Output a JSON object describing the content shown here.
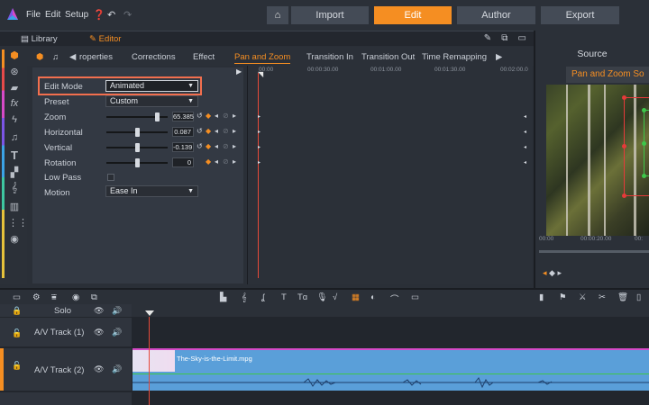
{
  "menu": {
    "file": "File",
    "edit": "Edit",
    "setup": "Setup"
  },
  "nav": {
    "import": "Import",
    "edit": "Edit",
    "author": "Author",
    "export": "Export"
  },
  "panel_tabs": {
    "library": "Library",
    "editor": "Editor"
  },
  "effect_tabs": [
    "roperties",
    "Corrections",
    "Effect",
    "Pan and Zoom",
    "Transition In",
    "Transition Out",
    "Time Remapping"
  ],
  "active_effect_tab": "Pan and Zoom",
  "properties": {
    "edit_mode_label": "Edit Mode",
    "edit_mode_value": "Animated",
    "preset_label": "Preset",
    "preset_value": "Custom",
    "zoom_label": "Zoom",
    "zoom_value": "65.385",
    "horizontal_label": "Horizontal",
    "horizontal_value": "0.087",
    "vertical_label": "Vertical",
    "vertical_value": "-0.139",
    "rotation_label": "Rotation",
    "rotation_value": "0",
    "low_pass_label": "Low Pass",
    "motion_label": "Motion",
    "motion_value": "Ease In"
  },
  "keyframe_ruler": [
    "00:00",
    "00:00:30.00",
    "00:01:00.00",
    "00:01:30.00",
    "00:02:00.0"
  ],
  "source": {
    "title": "Source",
    "subtitle": "Pan and Zoom So",
    "ruler": [
      "00:00",
      "00:00:20.00",
      "00:"
    ]
  },
  "tracks": {
    "solo_label": "Solo",
    "track1": "A/V Track (1)",
    "track2": "A/V Track (2)",
    "clip_name": "The-Sky-is-the-Limit.mpg"
  },
  "colors": {
    "accent": "#f58e22",
    "highlight": "#f36f4e",
    "clip": "#5a9fd9"
  }
}
